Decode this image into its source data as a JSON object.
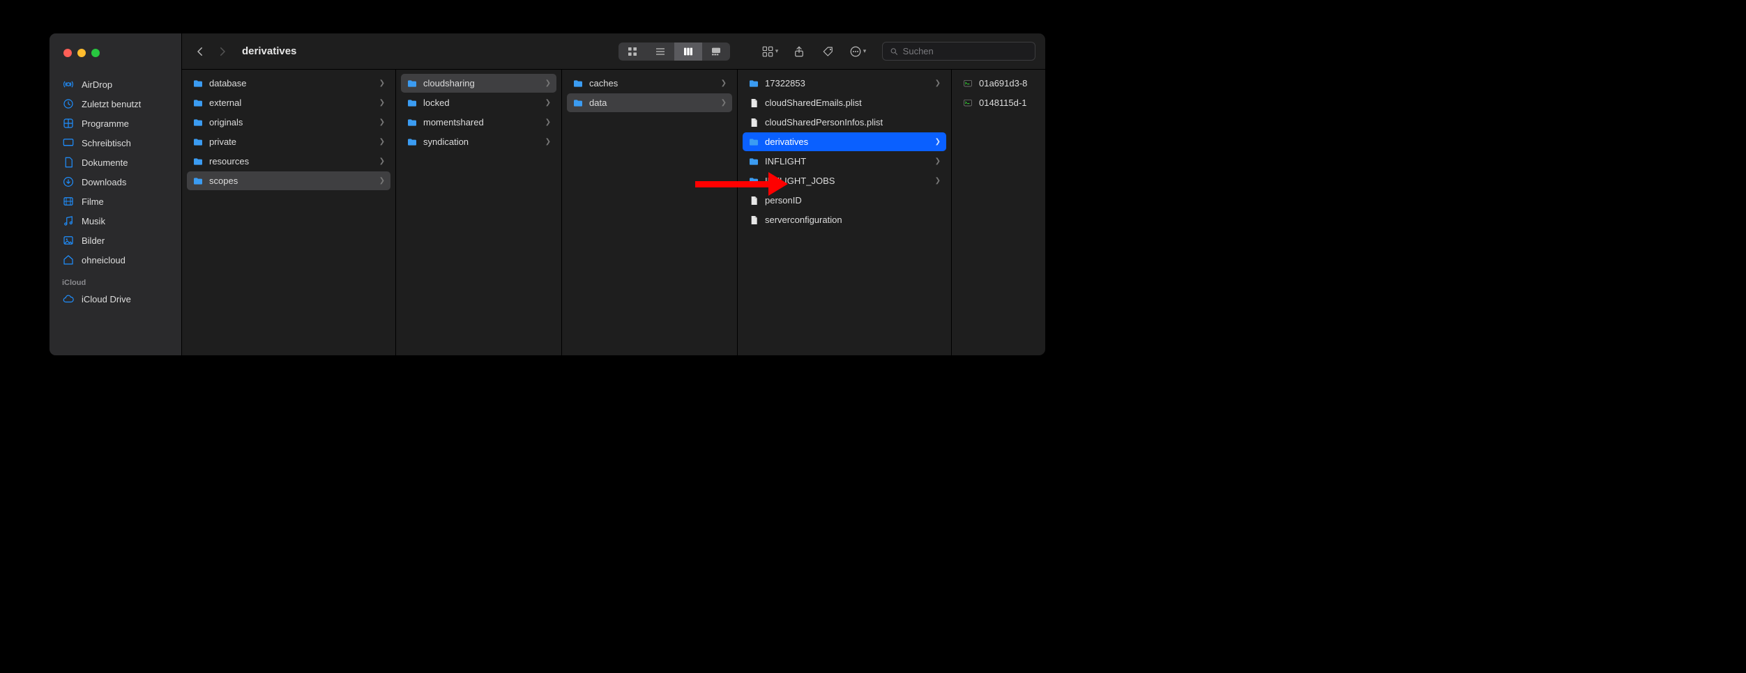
{
  "window": {
    "title": "derivatives"
  },
  "search": {
    "placeholder": "Suchen"
  },
  "sidebar": {
    "items": [
      {
        "icon": "airdrop",
        "label": "AirDrop"
      },
      {
        "icon": "clock",
        "label": "Zuletzt benutzt"
      },
      {
        "icon": "app",
        "label": "Programme"
      },
      {
        "icon": "desktop",
        "label": "Schreibtisch"
      },
      {
        "icon": "doc",
        "label": "Dokumente"
      },
      {
        "icon": "download",
        "label": "Downloads"
      },
      {
        "icon": "film",
        "label": "Filme"
      },
      {
        "icon": "music",
        "label": "Musik"
      },
      {
        "icon": "image",
        "label": "Bilder"
      },
      {
        "icon": "house",
        "label": "ohneicloud"
      }
    ],
    "section2_header": "iCloud",
    "section2_items": [
      {
        "icon": "cloud",
        "label": "iCloud Drive"
      }
    ]
  },
  "columns": [
    {
      "items": [
        {
          "type": "folder",
          "name": "database",
          "hasSub": true
        },
        {
          "type": "folder",
          "name": "external",
          "hasSub": true
        },
        {
          "type": "folder",
          "name": "originals",
          "hasSub": true
        },
        {
          "type": "folder",
          "name": "private",
          "hasSub": true
        },
        {
          "type": "folder",
          "name": "resources",
          "hasSub": true
        },
        {
          "type": "folder",
          "name": "scopes",
          "hasSub": true,
          "selected": "grey"
        }
      ]
    },
    {
      "items": [
        {
          "type": "folder",
          "name": "cloudsharing",
          "hasSub": true,
          "selected": "grey"
        },
        {
          "type": "folder",
          "name": "locked",
          "hasSub": true
        },
        {
          "type": "folder",
          "name": "momentshared",
          "hasSub": true
        },
        {
          "type": "folder",
          "name": "syndication",
          "hasSub": true
        }
      ]
    },
    {
      "items": [
        {
          "type": "folder",
          "name": "caches",
          "hasSub": true
        },
        {
          "type": "folder",
          "name": "data",
          "hasSub": true,
          "selected": "grey"
        }
      ]
    },
    {
      "items": [
        {
          "type": "folder",
          "name": "17322853",
          "hasSub": true
        },
        {
          "type": "file",
          "name": "cloudSharedEmails.plist"
        },
        {
          "type": "file",
          "name": "cloudSharedPersonInfos.plist"
        },
        {
          "type": "folder",
          "name": "derivatives",
          "hasSub": true,
          "selected": "blue"
        },
        {
          "type": "folder",
          "name": "INFLIGHT",
          "hasSub": true
        },
        {
          "type": "folder",
          "name": "INFLIGHT_JOBS",
          "hasSub": true
        },
        {
          "type": "file",
          "name": "personID"
        },
        {
          "type": "file",
          "name": "serverconfiguration"
        }
      ]
    },
    {
      "items": [
        {
          "type": "exec",
          "name": "01a691d3-8"
        },
        {
          "type": "exec",
          "name": "0148115d-1"
        }
      ]
    }
  ]
}
